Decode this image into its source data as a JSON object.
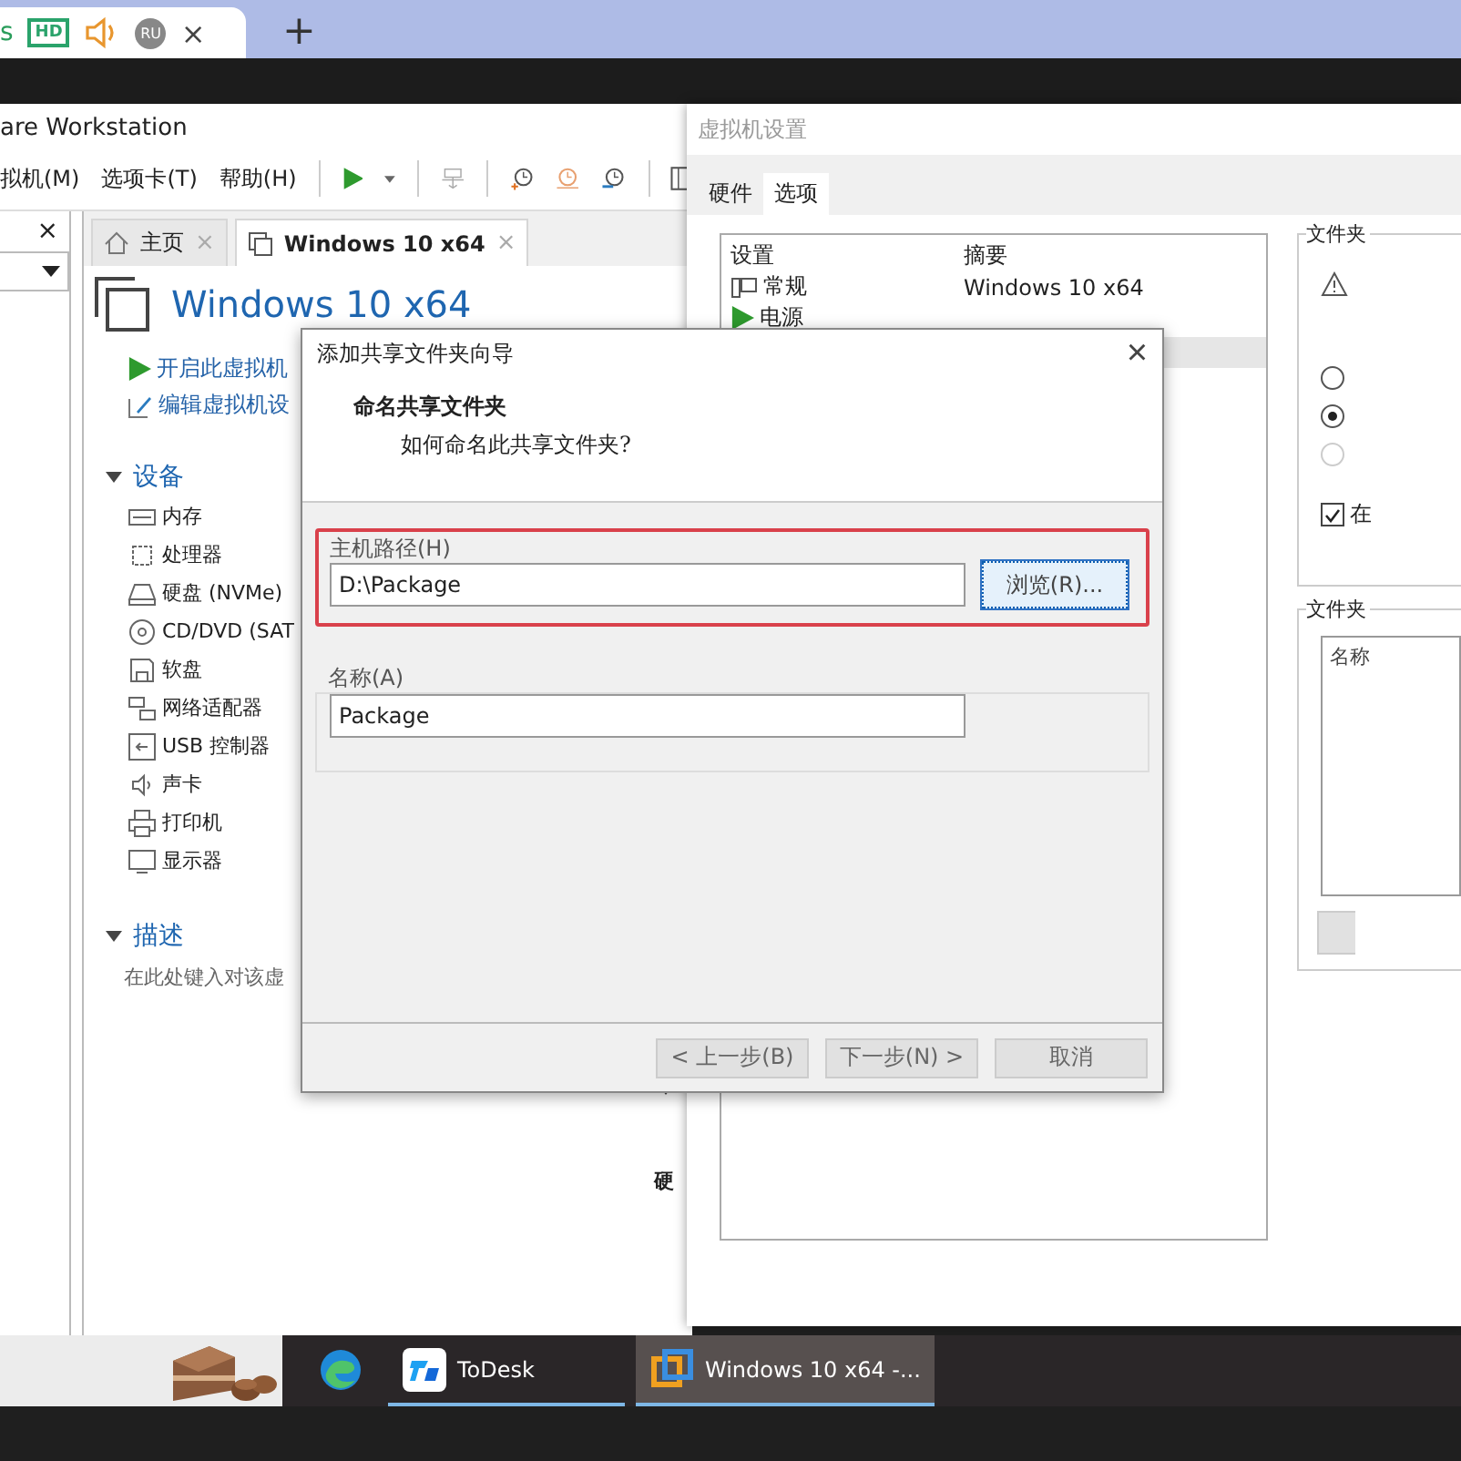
{
  "browser_tabs": {
    "tab_text": "s",
    "badge": "HD",
    "avatar": "RU",
    "close": "×",
    "new_tab": "+"
  },
  "workstation": {
    "title": "are Workstation",
    "menu": [
      "拟机(M)",
      "选项卡(T)",
      "帮助(H)"
    ],
    "library_close": "×",
    "tabs": [
      {
        "kind": "home",
        "label": "主页",
        "close": "×",
        "selected": false
      },
      {
        "kind": "vm",
        "label": "Windows 10 x64",
        "close": "×",
        "selected": true
      }
    ],
    "vm_title": "Windows 10 x64",
    "actions": [
      {
        "kind": "power",
        "label": "开启此虚拟机"
      },
      {
        "kind": "edit",
        "label": "编辑虚拟机设"
      }
    ],
    "devices_heading": "设备",
    "devices": [
      {
        "kind": "memory",
        "label": "内存"
      },
      {
        "kind": "cpu",
        "label": "处理器"
      },
      {
        "kind": "disk",
        "label": "硬盘 (NVMe)"
      },
      {
        "kind": "cd",
        "label": "CD/DVD (SAT"
      },
      {
        "kind": "floppy",
        "label": "软盘"
      },
      {
        "kind": "network",
        "label": "网络适配器"
      },
      {
        "kind": "usb",
        "label": "USB 控制器"
      },
      {
        "kind": "sound",
        "label": "声卡"
      },
      {
        "kind": "printer",
        "label": "打印机"
      },
      {
        "kind": "display",
        "label": "显示器"
      }
    ],
    "description_heading": "描述",
    "description_placeholder": "在此处键入对该虚",
    "details_fragment": "硬"
  },
  "settings": {
    "title": "虚拟机设置",
    "tabs": [
      {
        "label": "硬件",
        "selected": false
      },
      {
        "label": "选项",
        "selected": true
      }
    ],
    "columns": [
      "设置",
      "摘要"
    ],
    "rows": [
      {
        "kind": "general",
        "setting": "常规",
        "summary": "Windows 10 x64"
      },
      {
        "kind": "power",
        "setting": "电源"
      }
    ],
    "folder_group": "文件夹",
    "radios": [
      {
        "selected": false,
        "disabled": false
      },
      {
        "selected": true,
        "disabled": false
      },
      {
        "selected": false,
        "disabled": true
      }
    ],
    "checkbox": {
      "label": "在",
      "checked": true
    },
    "folders_group": "文件夹",
    "folders_column": "名称"
  },
  "dialog": {
    "title": "添加共享文件夹向导",
    "close": "×",
    "heading": "命名共享文件夹",
    "subheading": "如何命名此共享文件夹?",
    "host_path": {
      "label": "主机路径(H)",
      "value": "D:\\Package"
    },
    "browse": "浏览(R)...",
    "name": {
      "label": "名称(A)",
      "value": "Package"
    },
    "buttons": [
      "< 上一步(B)",
      "下一步(N) >",
      "取消"
    ]
  },
  "taskbar": {
    "apps": [
      {
        "kind": "edge",
        "selected": false
      },
      {
        "kind": "todesk",
        "label": "ToDesk",
        "selected": false
      },
      {
        "kind": "vmware",
        "label": "Windows 10 x64 -...",
        "selected": true
      }
    ]
  }
}
